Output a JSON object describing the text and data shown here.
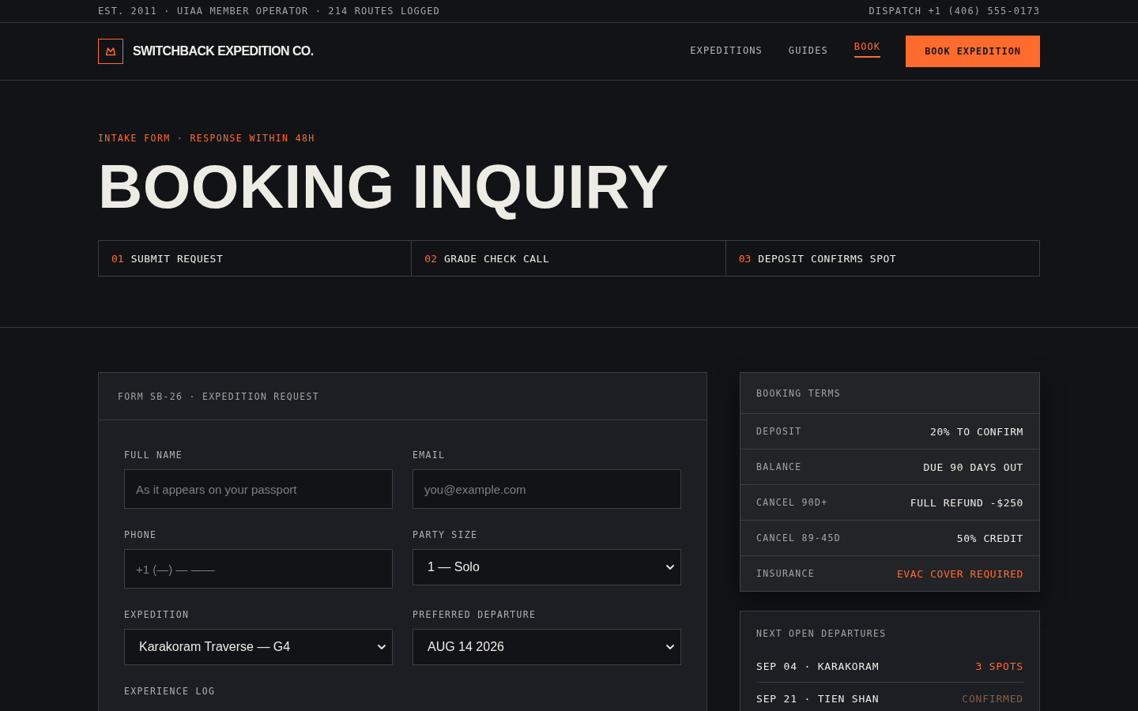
{
  "top_bar": {
    "info": "EST. 2011 · UIAA MEMBER OPERATOR · 214 ROUTES LOGGED",
    "dispatch": "DISPATCH +1 (406) 555-0173"
  },
  "nav": {
    "brand": "SWITCHBACK EXPEDITION CO.",
    "links": [
      {
        "label": "EXPEDITIONS",
        "selected": false
      },
      {
        "label": "GUIDES",
        "selected": false
      },
      {
        "label": "BOOK",
        "selected": true
      }
    ],
    "cta": "BOOK EXPEDITION"
  },
  "hero": {
    "eyebrow": "INTAKE FORM · RESPONSE WITHIN 48H",
    "title": "BOOKING INQUIRY",
    "steps": [
      {
        "number": "01",
        "label": "SUBMIT REQUEST"
      },
      {
        "number": "02",
        "label": "GRADE CHECK CALL"
      },
      {
        "number": "03",
        "label": "DEPOSIT CONFIRMS SPOT"
      }
    ]
  },
  "form": {
    "header": "FORM SB-26 · EXPEDITION REQUEST",
    "fields": [
      {
        "kind": "input",
        "label": "FULL NAME",
        "placeholder": "As it appears on your passport"
      },
      {
        "kind": "input",
        "label": "EMAIL",
        "placeholder": "you@example.com"
      },
      {
        "kind": "input",
        "label": "PHONE",
        "placeholder": "+1 (—) — ——"
      },
      {
        "kind": "select",
        "label": "PARTY SIZE",
        "value": "1 — Solo"
      },
      {
        "kind": "select",
        "label": "EXPEDITION",
        "value": "Karakoram Traverse — G4"
      },
      {
        "kind": "select",
        "label": "PREFERRED DEPARTURE",
        "value": "AUG 14 2026"
      },
      {
        "kind": "label",
        "label": "EXPERIENCE LOG"
      }
    ]
  },
  "booking_terms": {
    "title": "BOOKING TERMS",
    "rows": [
      {
        "label": "DEPOSIT",
        "value": "20% TO CONFIRM",
        "alert": false
      },
      {
        "label": "BALANCE",
        "value": "DUE 90 DAYS OUT",
        "alert": false
      },
      {
        "label": "CANCEL 90D+",
        "value": "FULL REFUND -$250",
        "alert": false
      },
      {
        "label": "CANCEL 89-45D",
        "value": "50% CREDIT",
        "alert": false
      },
      {
        "label": "INSURANCE",
        "value": "EVAC COVER REQUIRED",
        "alert": true
      }
    ]
  },
  "departures": {
    "title": "NEXT OPEN DEPARTURES",
    "rows": [
      {
        "trip": "SEP 04 · KARAKORAM",
        "status": "3 SPOTS",
        "kind": "open"
      },
      {
        "trip": "SEP 21 · TIEN SHAN",
        "status": "CONFIRMED",
        "kind": "confirmed"
      }
    ]
  }
}
